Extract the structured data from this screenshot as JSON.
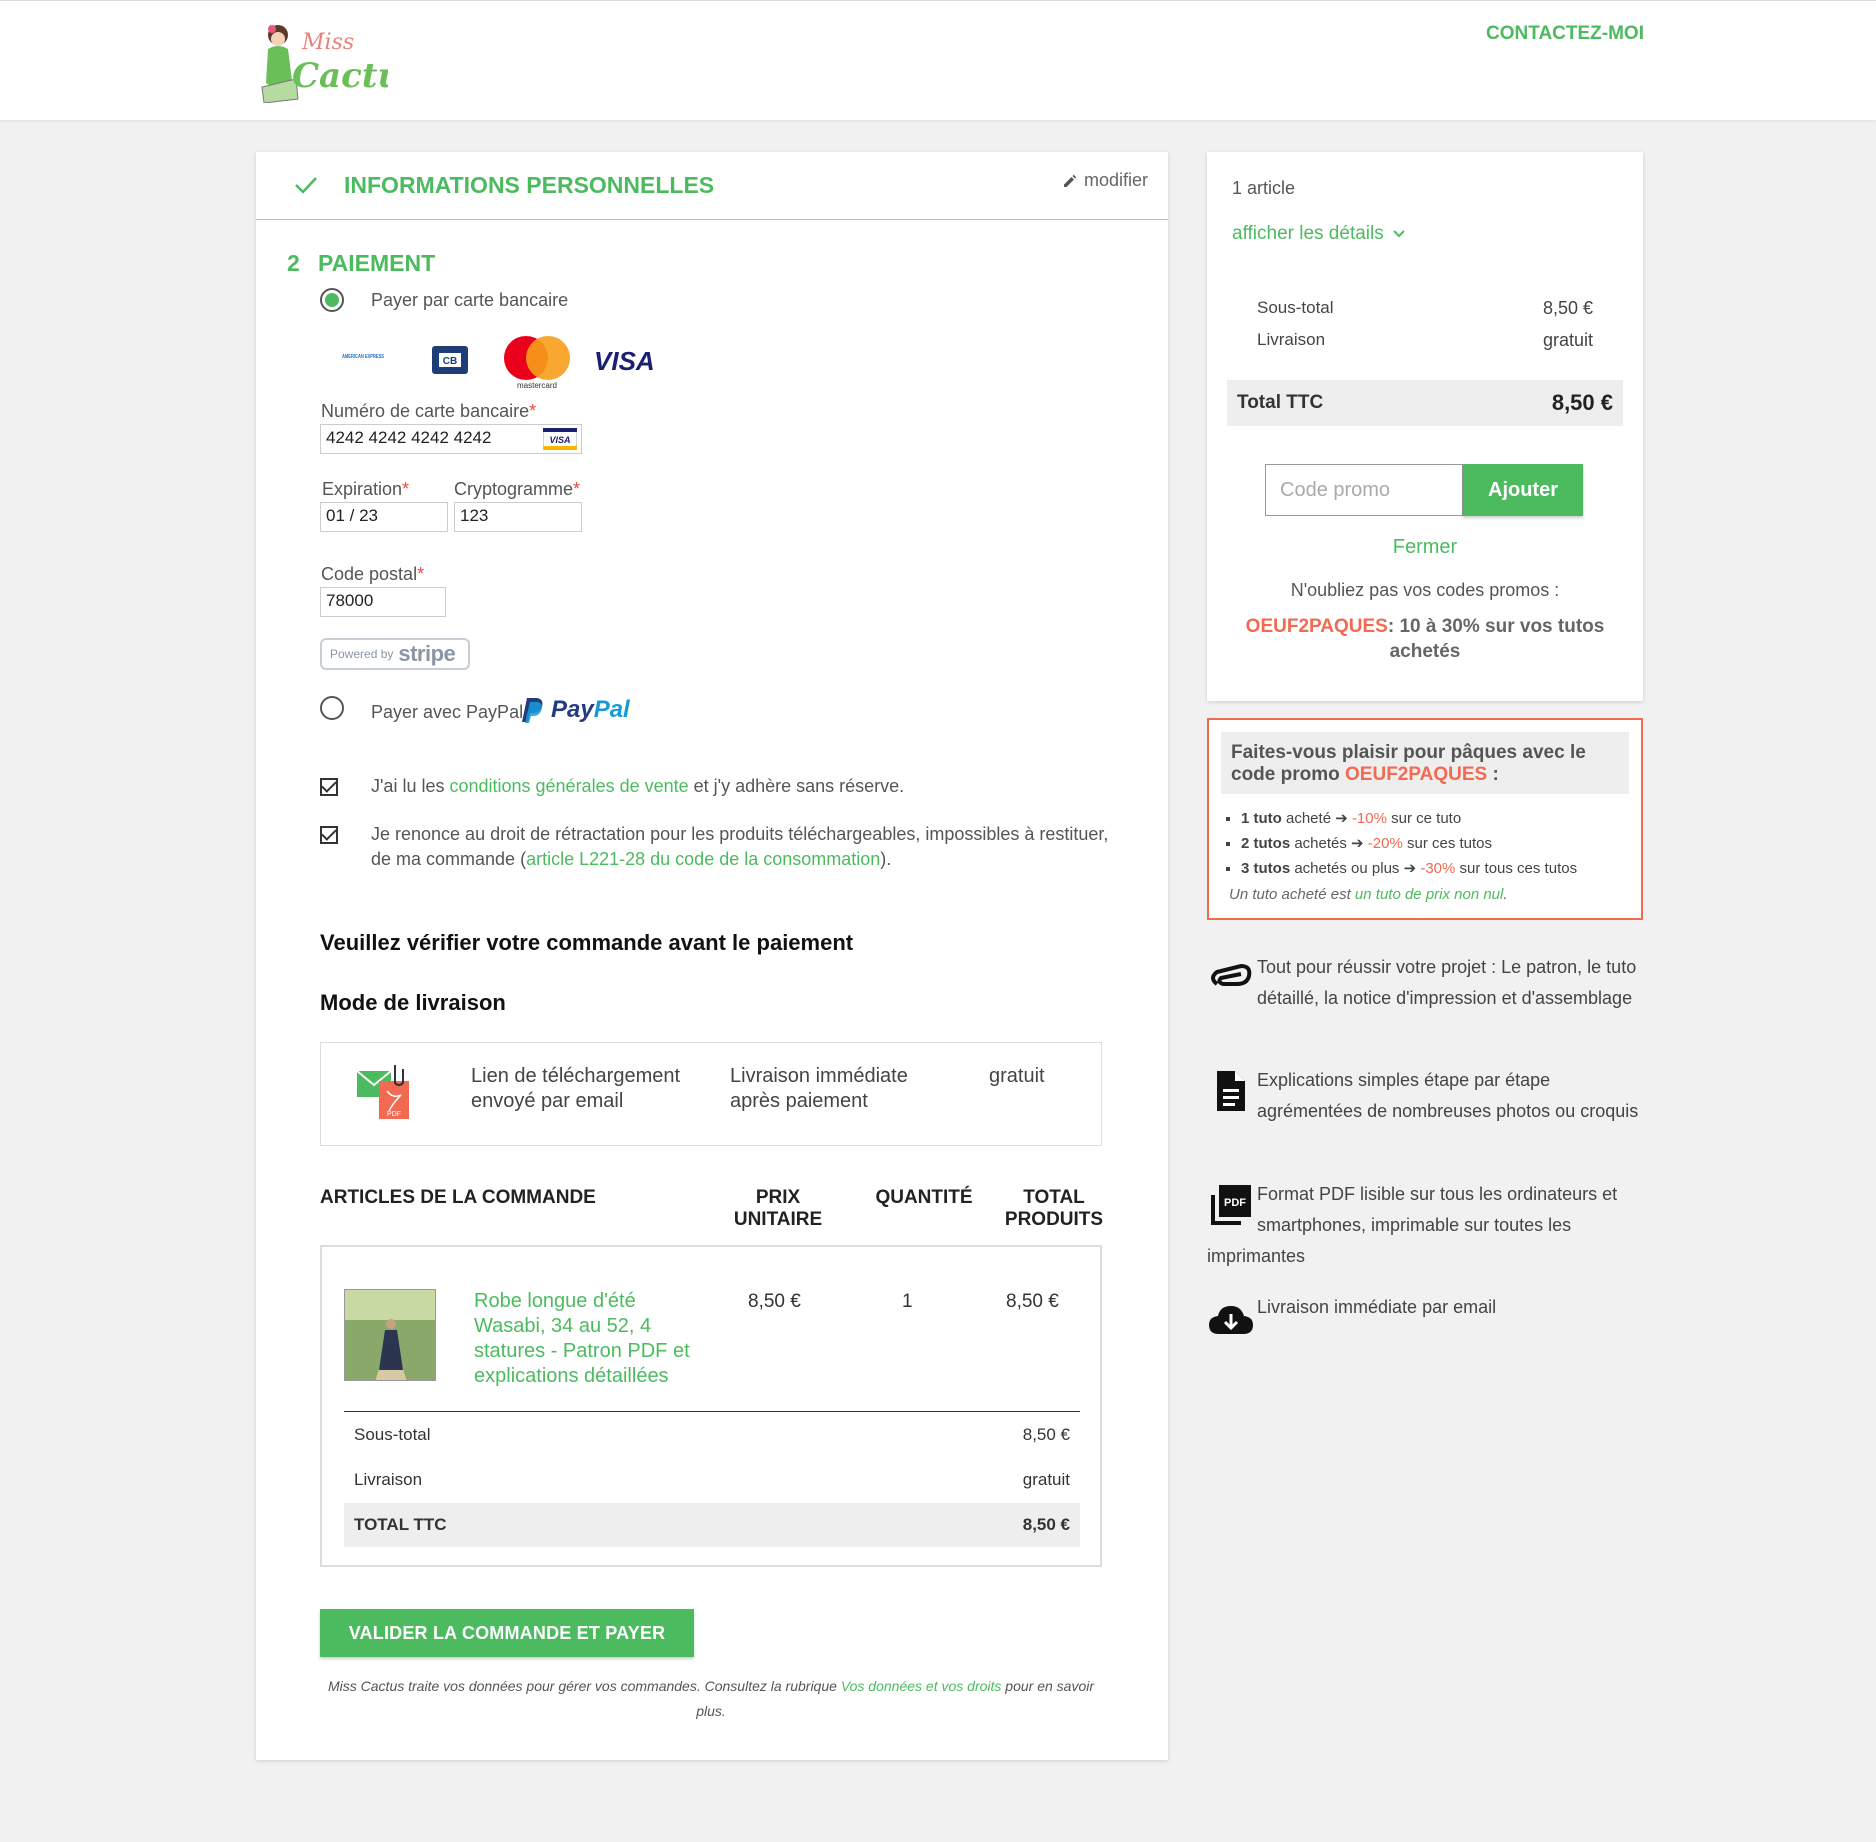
{
  "header": {
    "brand_top": "Miss",
    "brand_bottom": "Cactus",
    "contact": "CONTACTEZ-MOI"
  },
  "step1": {
    "title": "INFORMATIONS PERSONNELLES",
    "modify": "modifier"
  },
  "step2": {
    "number": "2",
    "title": "PAIEMENT",
    "card_option": "Payer par carte bancaire",
    "card_brands": [
      "AMERICAN EXPRESS",
      "CB",
      "mastercard",
      "VISA"
    ],
    "card_number_label": "Numéro de carte bancaire",
    "card_number_value": "4242 4242 4242 4242",
    "expiration_label": "Expiration",
    "expiration_value": "01 / 23",
    "cvc_label": "Cryptogramme",
    "cvc_value": "123",
    "postal_label": "Code postal",
    "postal_value": "78000",
    "required_mark": "*",
    "stripe_powered": "Powered by",
    "stripe_brand": "stripe",
    "paypal_option": "Payer avec PayPal",
    "paypal_brand_pay": "Pay",
    "paypal_brand_pal": "Pal",
    "cgv_before": "J'ai lu les ",
    "cgv_link": "conditions générales de vente",
    "cgv_after": " et j'y adhère sans réserve.",
    "retract_before": "Je renonce au droit de rétractation pour les produits téléchargeables, impossibles à restituer, de ma commande (",
    "retract_link": "article L221-28 du code de la consommation",
    "retract_after": ")."
  },
  "verify_title": "Veuillez vérifier votre commande avant le paiement",
  "delivery": {
    "title": "Mode de livraison",
    "icon_badge": "PDF",
    "method": "Lien de téléchargement envoyé par email",
    "timing": "Livraison immédiate après paiement",
    "price": "gratuit"
  },
  "order": {
    "col_items": "ARTICLES DE LA COMMANDE",
    "col_unit_price": "PRIX UNITAIRE",
    "col_quantity": "QUANTITÉ",
    "col_total": "TOTAL PRODUITS",
    "items": [
      {
        "name": "Robe longue d'été Wasabi, 34 au 52, 4 statures - Patron PDF et explications détaillées",
        "unit_price": "8,50 €",
        "quantity": "1",
        "total": "8,50 €"
      }
    ],
    "subtotal_label": "Sous-total",
    "subtotal_value": "8,50 €",
    "shipping_label": "Livraison",
    "shipping_value": "gratuit",
    "total_label": "TOTAL TTC",
    "total_value": "8,50 €"
  },
  "validate_button": "VALIDER LA COMMANDE ET PAYER",
  "legal": {
    "before": "Miss Cactus traite vos données pour gérer vos commandes. Consultez la rubrique ",
    "link": "Vos données et vos droits",
    "after": " pour en savoir plus."
  },
  "summary": {
    "count": "1 article",
    "show_details": "afficher les détails",
    "subtotal_label": "Sous-total",
    "subtotal_value": "8,50 €",
    "shipping_label": "Livraison",
    "shipping_value": "gratuit",
    "total_label": "Total TTC",
    "total_value": "8,50 €",
    "promo_placeholder": "Code promo",
    "promo_button": "Ajouter",
    "close": "Fermer",
    "reminder": "N'oubliez pas vos codes promos :",
    "reminder_code": "OEUF2PAQUES",
    "reminder_text": ": 10 à 30% sur vos tutos achetés"
  },
  "easter": {
    "head_before": "Faites-vous plaisir pour pâques avec le code promo ",
    "head_code": "OEUF2PAQUES",
    "head_after": " :",
    "lines": [
      {
        "bold": "1 tuto",
        "text": " acheté ➔ ",
        "pct": "-10%",
        "end": " sur ce tuto"
      },
      {
        "bold": "2 tutos",
        "text": " achetés ➔ ",
        "pct": "-20%",
        "end": " sur ces tutos"
      },
      {
        "bold": "3 tutos",
        "text": " achetés ou plus ➔ ",
        "pct": "-30%",
        "end": " sur tous ces tutos"
      }
    ],
    "note_before": "Un tuto acheté est ",
    "note_link": "un tuto de prix non nul",
    "note_after": "."
  },
  "features": [
    {
      "icon": "paperclip-icon",
      "text": "Tout pour réussir votre projet : Le patron, le tuto détaillé, la notice d'impression et d'assemblage"
    },
    {
      "icon": "document-icon",
      "text": "Explications simples étape par étape agrémentées de nombreuses photos ou croquis"
    },
    {
      "icon": "pdf-icon",
      "icon_label": "PDF",
      "text": "Format PDF lisible sur tous les ordinateurs et smartphones, imprimable sur toutes les imprimantes"
    },
    {
      "icon": "cloud-download-icon",
      "text": "Livraison immédiate par email"
    }
  ],
  "colors": {
    "accent": "#4cbb5f",
    "promo": "#f26a51"
  }
}
